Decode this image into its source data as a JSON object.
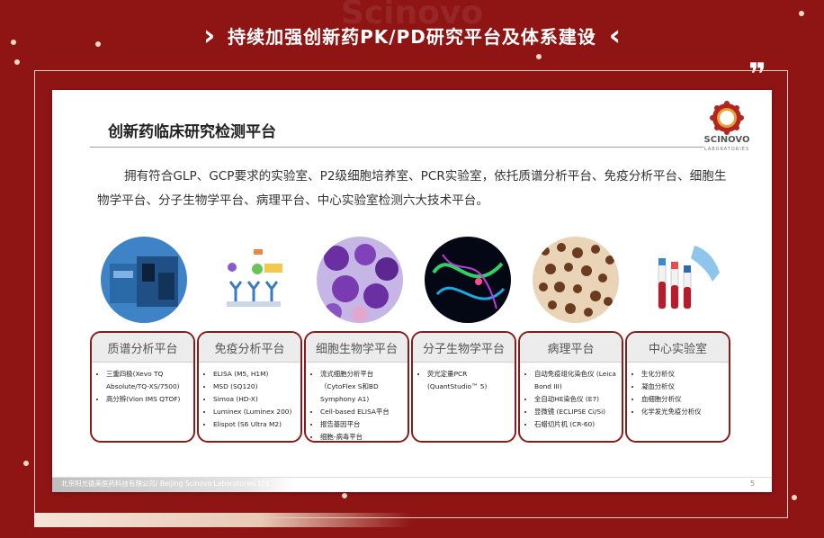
{
  "header": {
    "watermark": "Scinovo",
    "title": "持续加强创新药PK/PD研究平台及体系建设",
    "left_chevron": "›",
    "right_chevron": "‹",
    "quote_mark": "❞"
  },
  "slide": {
    "title": "创新药临床研究检测平台",
    "logo_text": "SCINOVO",
    "logo_sub": "LABORATORIES",
    "intro": "拥有符合GLP、GCP要求的实验室、P2级细胞培养室、PCR实验室，依托质谱分析平台、免疫分析平台、细胞生物学平台、分子生物学平台、病理平台、中心实验室检测六大技术平台。",
    "footer": "北京阳光德美医药科技有限公司/ Beijing Scinovo Laboratories Ltd.",
    "page_number": "5"
  },
  "platforms": [
    {
      "title": "质谱分析平台",
      "image": "mass-spectrometer-image",
      "items": [
        "三重四极(Xevo TQ Absolute/TQ-XS/7500)",
        "高分辨(Vion IMS QTOF)"
      ]
    },
    {
      "title": "免疫分析平台",
      "image": "antibody-diagram-image",
      "items": [
        "ELISA (M5, H1M)",
        "MSD (SQ120)",
        "Simoa (HD-X)",
        "Luminex (Luminex 200)",
        "Elispot (S6 Ultra M2)"
      ]
    },
    {
      "title": "细胞生物学平台",
      "image": "stained-cells-image",
      "items": [
        "流式细胞分析平台 （CytoFlex S和BD Symphony A1)",
        "Cell-based ELISA平台",
        "报告基因平台",
        "细胞-病毒平台"
      ]
    },
    {
      "title": "分子生物学平台",
      "image": "dna-fluorescence-image",
      "items": [
        "荧光定量PCR (QuantStudio™ 5)"
      ]
    },
    {
      "title": "病理平台",
      "image": "tissue-section-image",
      "items": [
        "自动免疫组化染色仪 (Leica Bond III)",
        "全自动HE染色仪 (E7)",
        "显微镜 (ECLIPSE Ci/Si)",
        "石蜡切片机 (CR-60)"
      ]
    },
    {
      "title": "中心实验室",
      "image": "blood-tubes-image",
      "items": [
        "生化分析仪",
        "凝血分析仪",
        "血细胞分析仪",
        "化学发光免疫分析仪"
      ]
    }
  ],
  "colors": {
    "background": "#8f1414",
    "card_border": "#8a1b1b",
    "accent": "#f3d9c6"
  }
}
